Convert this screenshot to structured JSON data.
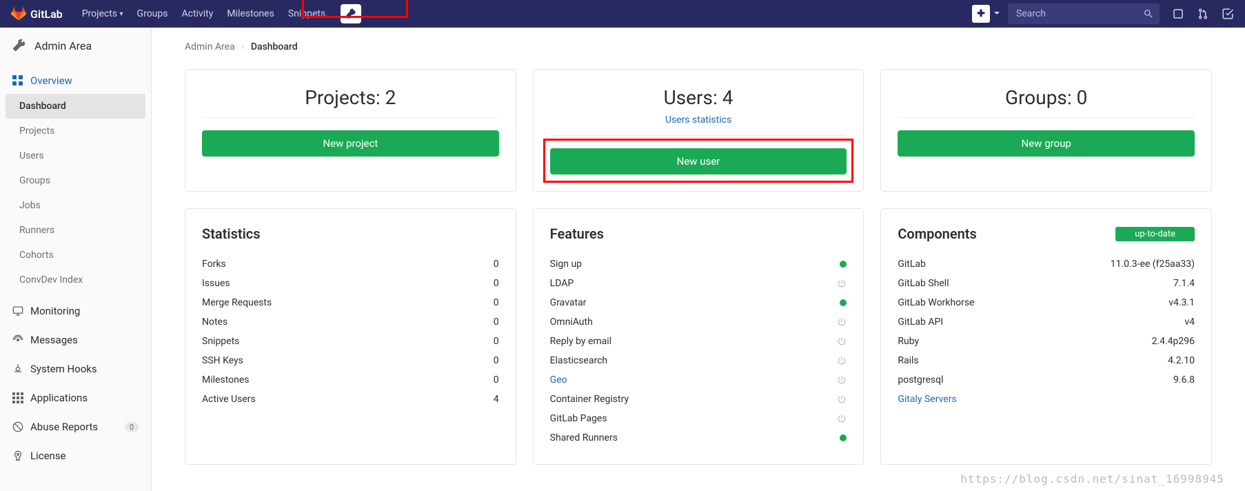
{
  "brand": "GitLab",
  "nav": {
    "projects": "Projects",
    "groups": "Groups",
    "activity": "Activity",
    "milestones": "Milestones",
    "snippets": "Snippets"
  },
  "search": {
    "placeholder": "Search"
  },
  "sidebar": {
    "title": "Admin Area",
    "overview": "Overview",
    "items": {
      "dashboard": "Dashboard",
      "projects": "Projects",
      "users": "Users",
      "groups": "Groups",
      "jobs": "Jobs",
      "runners": "Runners",
      "cohorts": "Cohorts",
      "convdev": "ConvDev Index"
    },
    "monitoring": "Monitoring",
    "messages": "Messages",
    "system_hooks": "System Hooks",
    "applications": "Applications",
    "abuse": "Abuse Reports",
    "abuse_count": "0",
    "license": "License"
  },
  "breadcrumb": {
    "root": "Admin Area",
    "current": "Dashboard"
  },
  "summary": {
    "projects": {
      "title": "Projects: 2",
      "button": "New project"
    },
    "users": {
      "title": "Users: 4",
      "link": "Users statistics",
      "button": "New user"
    },
    "groups": {
      "title": "Groups: 0",
      "button": "New group"
    }
  },
  "statistics": {
    "heading": "Statistics",
    "rows": [
      {
        "label": "Forks",
        "value": "0"
      },
      {
        "label": "Issues",
        "value": "0"
      },
      {
        "label": "Merge Requests",
        "value": "0"
      },
      {
        "label": "Notes",
        "value": "0"
      },
      {
        "label": "Snippets",
        "value": "0"
      },
      {
        "label": "SSH Keys",
        "value": "0"
      },
      {
        "label": "Milestones",
        "value": "0"
      },
      {
        "label": "Active Users",
        "value": "4"
      }
    ]
  },
  "features": {
    "heading": "Features",
    "rows": [
      {
        "label": "Sign up",
        "status": "on"
      },
      {
        "label": "LDAP",
        "status": "off"
      },
      {
        "label": "Gravatar",
        "status": "on"
      },
      {
        "label": "OmniAuth",
        "status": "off"
      },
      {
        "label": "Reply by email",
        "status": "off"
      },
      {
        "label": "Elasticsearch",
        "status": "off"
      },
      {
        "label": "Geo",
        "status": "off",
        "link": true
      },
      {
        "label": "Container Registry",
        "status": "off"
      },
      {
        "label": "GitLab Pages",
        "status": "off"
      },
      {
        "label": "Shared Runners",
        "status": "on"
      }
    ]
  },
  "components": {
    "heading": "Components",
    "badge": "up-to-date",
    "rows": [
      {
        "label": "GitLab",
        "value": "11.0.3-ee (f25aa33)"
      },
      {
        "label": "GitLab Shell",
        "value": "7.1.4"
      },
      {
        "label": "GitLab Workhorse",
        "value": "v4.3.1"
      },
      {
        "label": "GitLab API",
        "value": "v4"
      },
      {
        "label": "Ruby",
        "value": "2.4.4p296"
      },
      {
        "label": "Rails",
        "value": "4.2.10"
      },
      {
        "label": "postgresql",
        "value": "9.6.8"
      },
      {
        "label": "Gitaly Servers",
        "value": "",
        "link": true
      }
    ]
  },
  "watermark": "https://blog.csdn.net/sinat_16998945"
}
